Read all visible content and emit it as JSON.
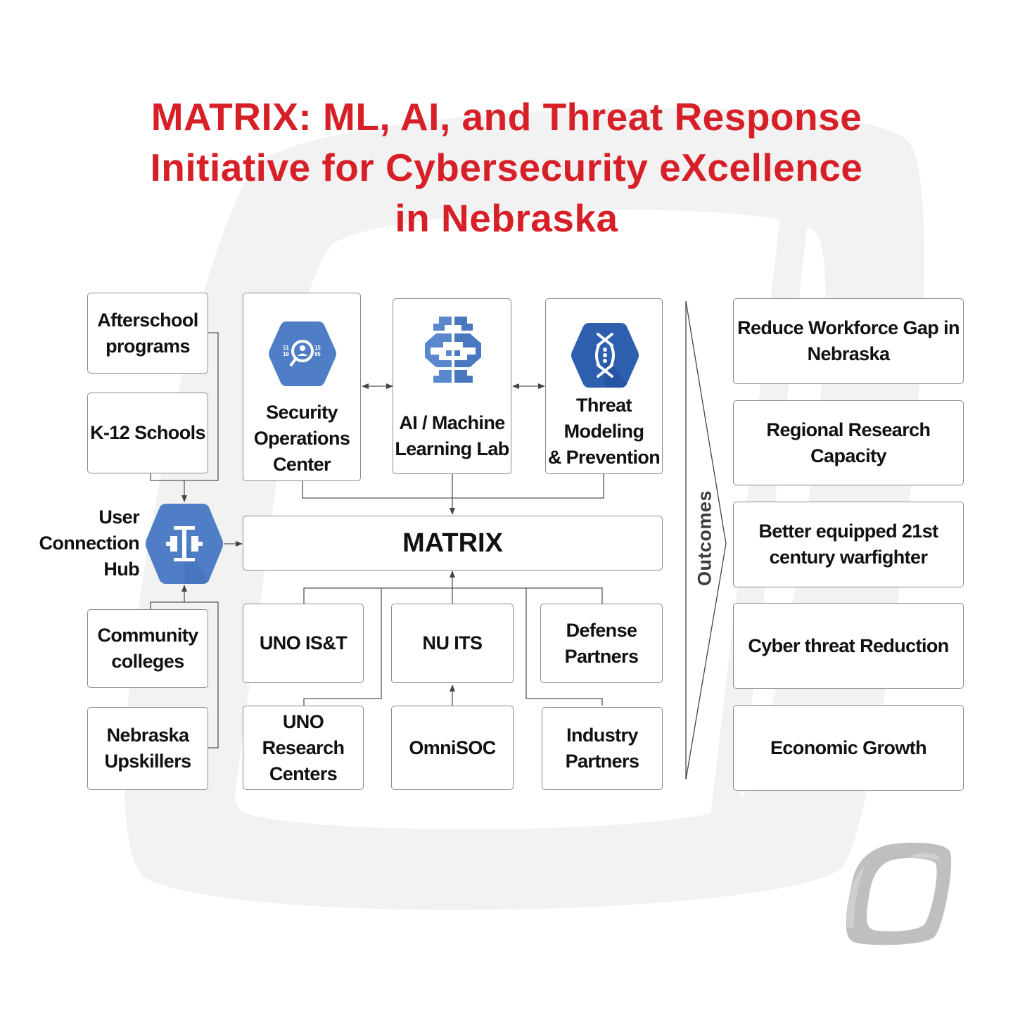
{
  "title": {
    "lines": [
      "MATRIX: ML, AI, and Threat Response",
      "Initiative for Cybersecurity eXcellence",
      "in Nebraska"
    ]
  },
  "colors": {
    "title": "#D71F27",
    "icon_blue": "#4F7EC6",
    "icon_blue_dark": "#2D5FAE",
    "box_border": "#8a8a8a",
    "watermark": "#f1f1f1",
    "logo_gray": "#bdbdbd"
  },
  "user_groups": [
    {
      "label": "Afterschool\nprograms"
    },
    {
      "label": "K-12 Schools"
    },
    {
      "label": "Community\ncolleges"
    },
    {
      "label": "Nebraska\nUpskillers"
    }
  ],
  "hub": {
    "label": "User\nConnection\nHub",
    "icon": "connection-hub-icon"
  },
  "labs": [
    {
      "label": "Security\nOperations\nCenter",
      "icon": "security-operations-icon"
    },
    {
      "label": "AI / Machine\nLearning Lab",
      "icon": "brain-icon"
    },
    {
      "label": "Threat\nModeling\n& Prevention",
      "icon": "threat-modeling-icon"
    }
  ],
  "core": {
    "label": "MATRIX"
  },
  "partners_row1": [
    {
      "label": "UNO IS&T"
    },
    {
      "label": "NU ITS"
    },
    {
      "label": "Defense\nPartners"
    }
  ],
  "partners_row2": [
    {
      "label": "UNO\nResearch\nCenters"
    },
    {
      "label": "OmniSOC"
    },
    {
      "label": "Industry\nPartners"
    }
  ],
  "outcomes": {
    "heading": "Outcomes",
    "items": [
      {
        "label": "Reduce Workforce Gap in\nNebraska"
      },
      {
        "label": "Regional Research\nCapacity"
      },
      {
        "label": "Better equipped 21st\ncentury warfighter"
      },
      {
        "label": "Cyber threat Reduction"
      },
      {
        "label": "Economic Growth"
      }
    ]
  }
}
